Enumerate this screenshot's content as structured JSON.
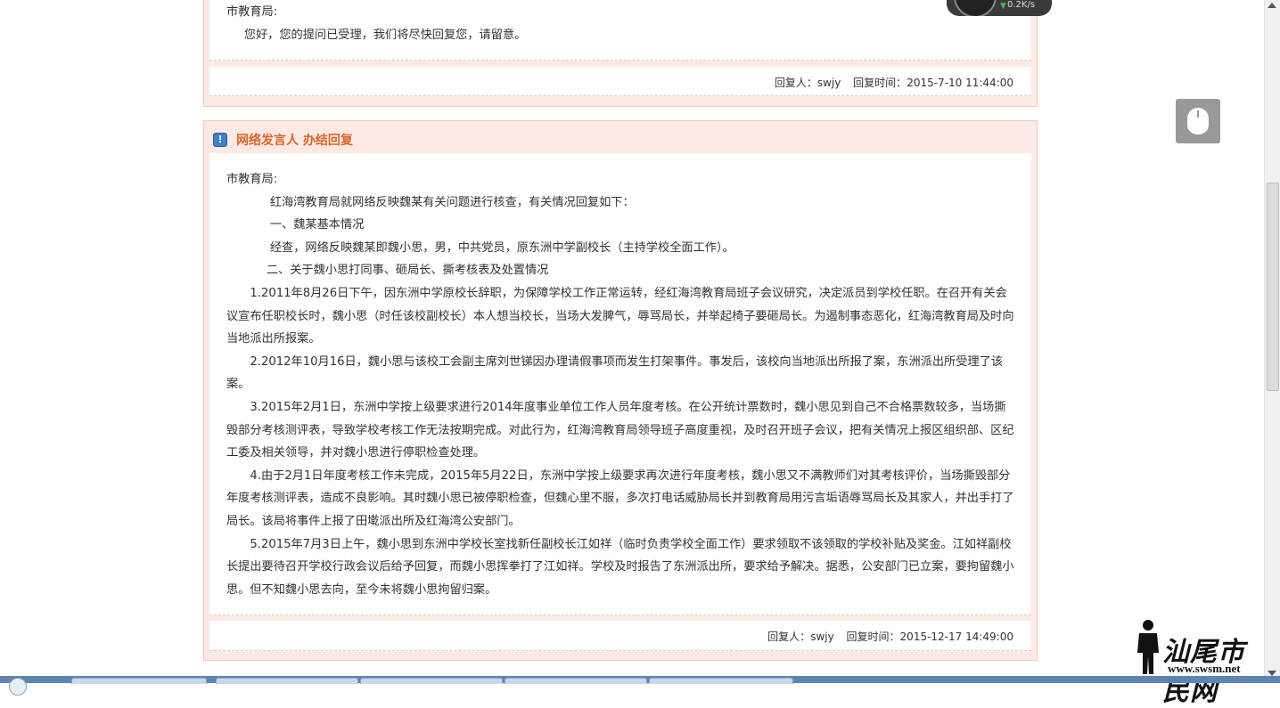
{
  "reply1": {
    "org": "市教育局:",
    "body": "您好，您的提问已受理，我们将尽快回复您，请留意。",
    "replier_label": "回复人：",
    "replier": "swjy",
    "time_label": "回复时间：",
    "time": "2015-7-10 11:44:00"
  },
  "reply2": {
    "title": "网络发言人 办结回复",
    "org": "市教育局:",
    "paragraphs": [
      "红海湾教育局就网络反映魏某有关问题进行核查，有关情况回复如下：",
      "一、魏某基本情况",
      "经查，网络反映魏某即魏小思，男，中共党员，原东洲中学副校长（主持学校全面工作）。",
      "二、关于魏小思打同事、砸局长、撕考核表及处置情况",
      "1.2011年8月26日下午，因东洲中学原校长辞职，为保障学校工作正常运转，经红海湾教育局班子会议研究，决定派员到学校任职。在召开有关会议宣布任职校长时，魏小思（时任该校副校长）本人想当校长，当场大发脾气，辱骂局长，并举起椅子要砸局长。为遏制事态恶化，红海湾教育局及时向当地派出所报案。",
      "2.2012年10月16日，魏小思与该校工会副主席刘世锑因办理请假事项而发生打架事件。事发后，该校向当地派出所报了案，东洲派出所受理了该案。",
      "3.2015年2月1日，东洲中学按上级要求进行2014年度事业单位工作人员年度考核。在公开统计票数时，魏小思见到自己不合格票数较多，当场撕毁部分考核测评表，导致学校考核工作无法按期完成。对此行为，红海湾教育局领导班子高度重视，及时召开班子会议，把有关情况上报区组织部、区纪工委及相关领导，并对魏小思进行停职检查处理。",
      "4.由于2月1日年度考核工作未完成，2015年5月22日，东洲中学按上级要求再次进行年度考核，魏小思又不满教师们对其考核评价，当场撕毁部分年度考核测评表，造成不良影响。其时魏小思已被停职检查，但魏心里不服，多次打电话威胁局长并到教育局用污言垢语辱骂局长及其家人，并出手打了局长。该局将事件上报了田墘派出所及红海湾公安部门。",
      "5.2015年7月3日上午，魏小思到东洲中学校长室找新任副校长江如祥（临时负责学校全面工作）要求领取不该领取的学校补贴及奖金。江如祥副校长提出要待召开学校行政会议后给予回复，而魏小思挥拳打了江如祥。学校及时报告了东洲派出所，要求给予解决。据悉，公安部门已立案，要拘留魏小思。但不知魏小思去向，至今未将魏小思拘留归案。"
    ],
    "replier_label": "回复人：",
    "replier": "swjy",
    "time_label": "回复时间：",
    "time": "2015-12-17 14:49:00"
  },
  "speed_widget": {
    "value": "0.2K/s"
  },
  "logo": {
    "brand": "汕尾市民网",
    "url": "www.swsm.net"
  },
  "colors": {
    "panel_bg": "#fde9e3",
    "panel_border": "#f4c8ba",
    "title": "#d9652b",
    "icon": "#3d7fd0"
  }
}
